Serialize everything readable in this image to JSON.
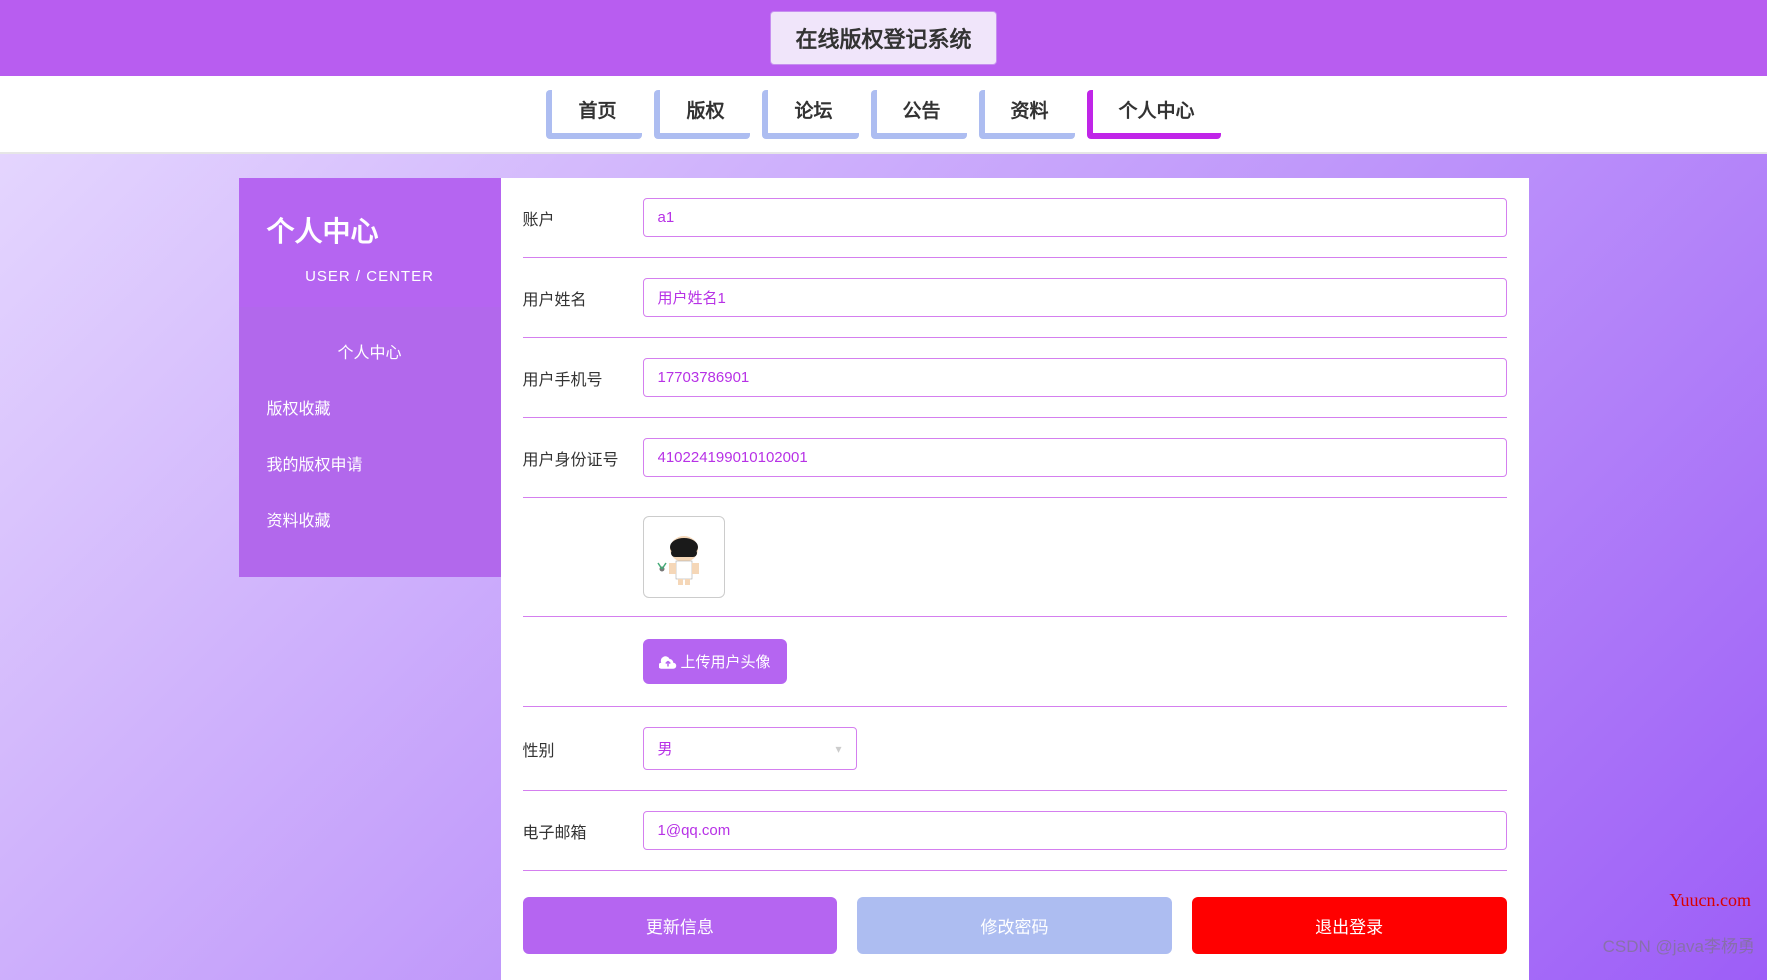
{
  "colors": {
    "accent": "#b565f1",
    "accent_border": "#d47fef",
    "nav_idle": "#adbdf1",
    "nav_active": "#c025e8",
    "danger": "#ff0000"
  },
  "header": {
    "system_title": "在线版权登记系统"
  },
  "nav": {
    "items": [
      {
        "label": "首页",
        "active": false
      },
      {
        "label": "版权",
        "active": false
      },
      {
        "label": "论坛",
        "active": false
      },
      {
        "label": "公告",
        "active": false
      },
      {
        "label": "资料",
        "active": false
      },
      {
        "label": "个人中心",
        "active": true
      }
    ]
  },
  "sidebar": {
    "title": "个人中心",
    "subtitle": "USER / CENTER",
    "items": [
      {
        "label": "个人中心",
        "active": true
      },
      {
        "label": "版权收藏",
        "active": false
      },
      {
        "label": "我的版权申请",
        "active": false
      },
      {
        "label": "资料收藏",
        "active": false
      }
    ]
  },
  "form": {
    "account_label": "账户",
    "account_value": "a1",
    "name_label": "用户姓名",
    "name_value": "用户姓名1",
    "phone_label": "用户手机号",
    "phone_value": "17703786901",
    "idcard_label": "用户身份证号",
    "idcard_value": "410224199010102001",
    "upload_label": "上传用户头像",
    "gender_label": "性别",
    "gender_value": "男",
    "email_label": "电子邮箱",
    "email_value": "1@qq.com"
  },
  "actions": {
    "update": "更新信息",
    "change_password": "修改密码",
    "logout": "退出登录"
  },
  "watermarks": {
    "yuucn": "Yuucn.com",
    "csdn": "CSDN @java李杨勇"
  }
}
